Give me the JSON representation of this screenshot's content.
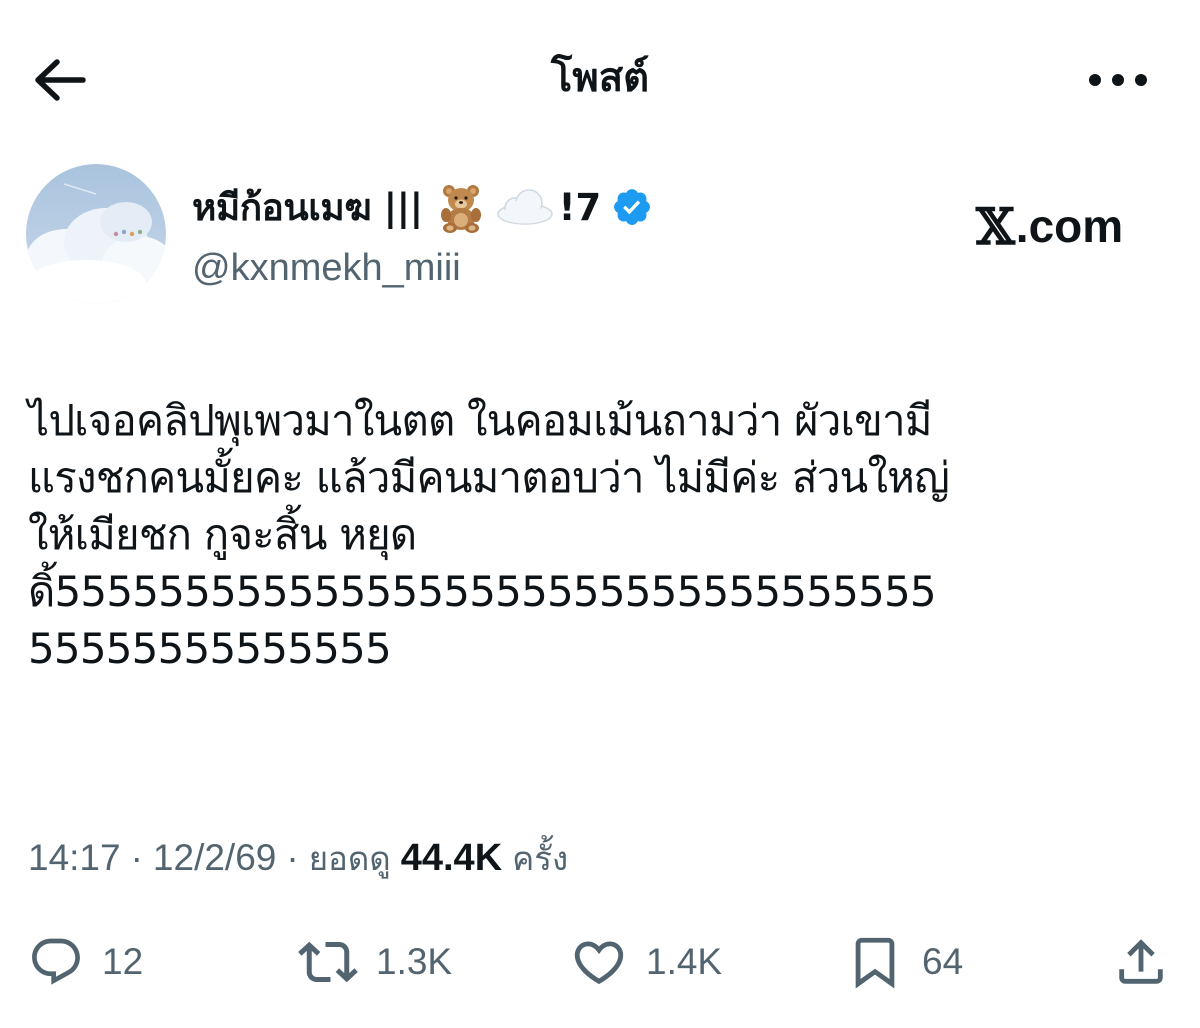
{
  "header": {
    "title": "โพสต์",
    "back_icon": "arrow-left-icon",
    "more_icon": "more-horizontal-icon"
  },
  "author": {
    "display_name": "หมีก้อนเมฆ |||",
    "name_emojis": [
      "teddy-bear-emoji",
      "cloud-emoji"
    ],
    "name_suffix": "!7",
    "handle": "@kxnmekh_miii",
    "verified": true,
    "verified_color": "#1d9bf0"
  },
  "brand": {
    "x_glyph": "𝕏",
    "domain": ".com"
  },
  "post": {
    "lines": [
      "ไปเจอคลิปพุเพวมาในตต ในคอมเม้นถามว่า ผัวเขามี",
      "แรงชกคนมั้ยคะ แล้วมีคนมาตอบว่า ไม่มีค่ะ ส่วนใหญ่",
      "ให้เมียชก กูจะสิ้น หยุด",
      "ดิ้5555555555555555555555555555555555",
      "55555555555555"
    ]
  },
  "meta": {
    "time": "14:17",
    "separator": "·",
    "date": "12/2/69",
    "views_label": "ยอดดู",
    "views_count": "44.4K",
    "views_unit": "ครั้ง"
  },
  "actions": {
    "reply_count": "12",
    "repost_count": "1.3K",
    "like_count": "1.4K",
    "bookmark_count": "64"
  },
  "colors": {
    "text_primary": "#0f1419",
    "text_secondary": "#536471",
    "icon": "#536471",
    "verified": "#1d9bf0"
  }
}
